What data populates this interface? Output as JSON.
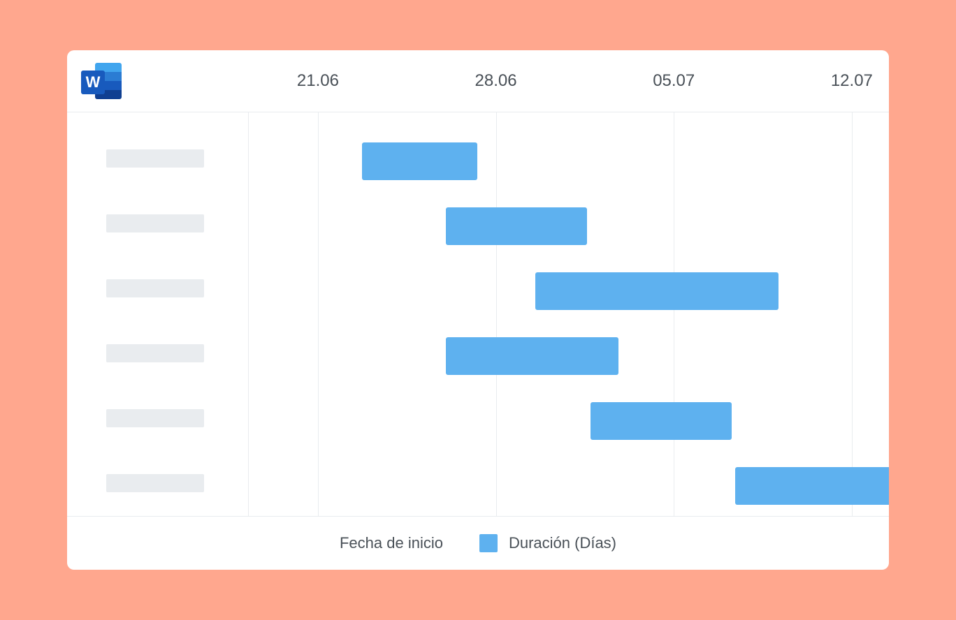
{
  "chart_data": {
    "type": "bar",
    "orientation": "horizontal-gantt",
    "time_axis_labels": [
      "21.06",
      "28.06",
      "05.07",
      "12.07"
    ],
    "series": [
      {
        "name": "Fecha de inicio"
      },
      {
        "name": "Duración (Días)"
      }
    ],
    "tasks": [
      {
        "start_pct": 17.7,
        "width_pct": 18.0
      },
      {
        "start_pct": 30.8,
        "width_pct": 22.0
      },
      {
        "start_pct": 44.8,
        "width_pct": 38.0
      },
      {
        "start_pct": 30.8,
        "width_pct": 27.0
      },
      {
        "start_pct": 53.4,
        "width_pct": 22.0
      },
      {
        "start_pct": 76.0,
        "width_pct": 32.0
      }
    ],
    "grid_positions_pct": [
      10.8,
      38.6,
      66.4,
      94.2
    ]
  },
  "legend": {
    "left": "Fecha de inicio",
    "right": "Duración (Días)"
  },
  "dates": [
    "21.06",
    "28.06",
    "05.07",
    "12.07"
  ]
}
